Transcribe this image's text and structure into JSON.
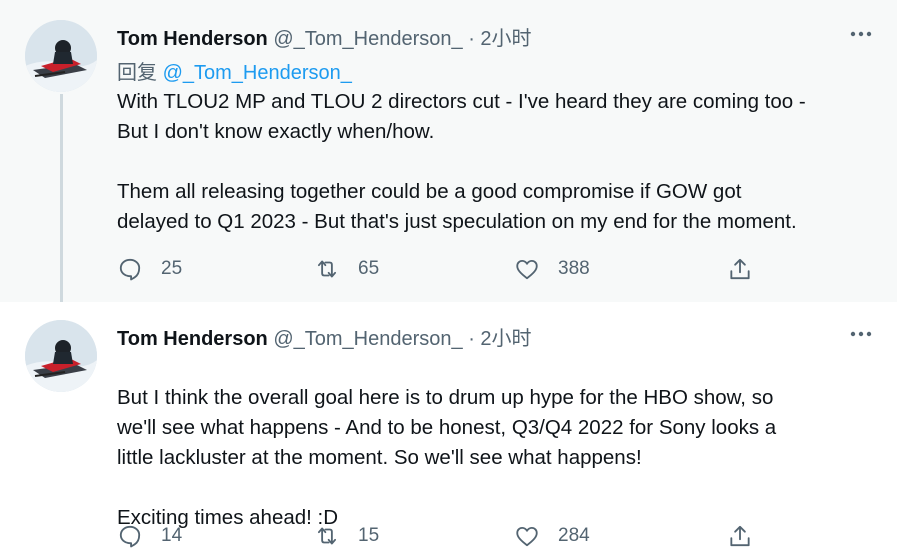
{
  "tweets": [
    {
      "author_name": "Tom Henderson",
      "author_handle": "@_Tom_Henderson_",
      "separator": "·",
      "time": "2小时",
      "reply_prefix": "回复",
      "reply_to": "@_Tom_Henderson_",
      "lines": [
        "With TLOU2 MP and TLOU 2 directors cut - I've heard they are coming too -",
        "But I don't know exactly when/how.",
        "",
        "Them all releasing together could be a good compromise if GOW got",
        "delayed to Q1 2023 - But that's just speculation on my end for the moment."
      ],
      "replies": "25",
      "retweets": "65",
      "likes": "388"
    },
    {
      "author_name": "Tom Henderson",
      "author_handle": "@_Tom_Henderson_",
      "separator": "·",
      "time": "2小时",
      "lines": [
        "But I think the overall goal here is to drum up hype for the HBO show, so",
        "we'll see what happens - And to be honest, Q3/Q4 2022 for Sony looks a",
        "little lackluster at the moment. So we'll see what happens!",
        "",
        "Exciting times ahead! :D"
      ],
      "replies": "14",
      "retweets": "15",
      "likes": "284"
    }
  ],
  "icons": {
    "more": "more-horizontal-icon",
    "reply": "speech-bubble-icon",
    "retweet": "retweet-arrows-icon",
    "like": "heart-icon",
    "share": "share-upload-icon"
  },
  "colors": {
    "text": "#0f1419",
    "secondary": "#536471",
    "link": "#1d9bf0",
    "highlight_bg": "#f7f9f9",
    "thread_line": "#cfd9de"
  }
}
